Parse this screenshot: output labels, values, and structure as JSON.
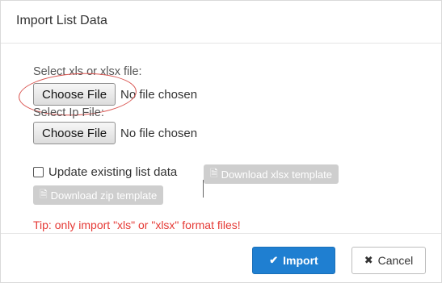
{
  "dialog": {
    "title": "Import List Data"
  },
  "xls_file": {
    "label": "Select xls or xlsx file:",
    "button": "Choose File",
    "status": "No file chosen"
  },
  "ip_file": {
    "label": "Select Ip File:",
    "button": "Choose File",
    "status": "No file chosen"
  },
  "options": {
    "update_existing_label": "Update existing list data",
    "update_existing_checked": false
  },
  "templates": {
    "xlsx_label": "Download xlsx template",
    "zip_label": "Download zip template"
  },
  "tip": "Tip: only import \"xls\" or \"xlsx\" format files!",
  "footer": {
    "import_label": "Import",
    "cancel_label": "Cancel"
  },
  "colors": {
    "primary": "#1f7fd1",
    "tip": "#e53935",
    "annotation": "#d9534f",
    "disabled": "#c9c9c9"
  }
}
